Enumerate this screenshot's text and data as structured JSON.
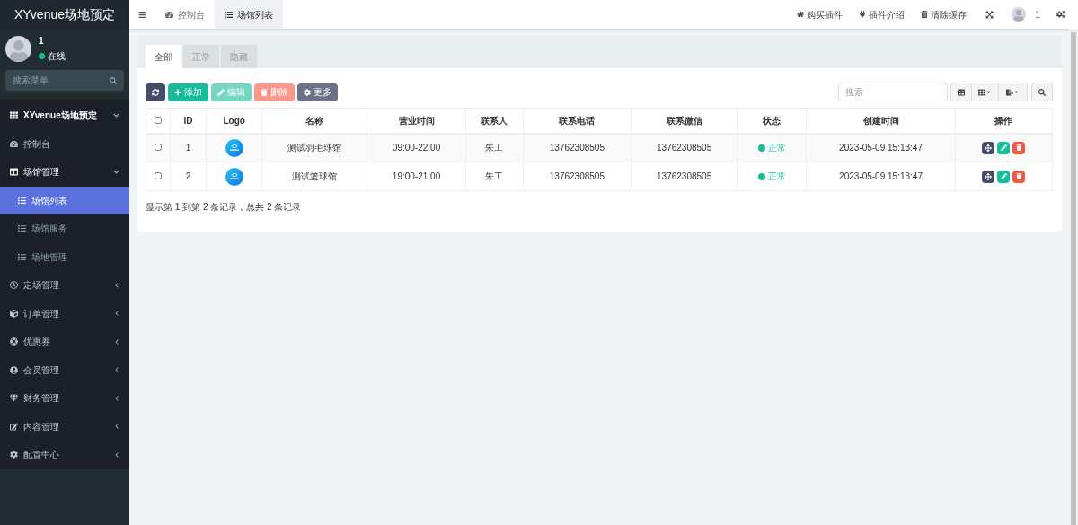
{
  "sidebar": {
    "brand": "XYvenue场地预定",
    "user": {
      "name": "1",
      "status": "在线",
      "online": true
    },
    "search": {
      "placeholder": "搜索菜单"
    },
    "menu": [
      {
        "kind": "header",
        "label": "XYvenue场地预定",
        "expanded": true
      },
      {
        "kind": "item",
        "label": "控制台",
        "selected": false
      },
      {
        "kind": "item",
        "label": "场馆管理",
        "expanded": true,
        "selected": false,
        "children": [
          {
            "label": "场馆列表",
            "selected": true
          },
          {
            "label": "场馆服务",
            "selected": false
          },
          {
            "label": "场地管理",
            "selected": false
          }
        ]
      },
      {
        "kind": "item",
        "label": "定场管理",
        "expanded": false,
        "selected": false
      },
      {
        "kind": "item",
        "label": "订单管理",
        "expanded": false,
        "selected": false
      },
      {
        "kind": "item",
        "label": "优惠券",
        "expanded": false,
        "selected": false
      },
      {
        "kind": "item",
        "label": "会员管理",
        "expanded": false,
        "selected": false
      },
      {
        "kind": "item",
        "label": "财务管理",
        "expanded": false,
        "selected": false
      },
      {
        "kind": "item",
        "label": "内容管理",
        "expanded": false,
        "selected": false
      },
      {
        "kind": "item",
        "label": "配置中心",
        "expanded": false,
        "selected": false
      }
    ]
  },
  "topbar": {
    "tabs": [
      {
        "label": "控制台",
        "selected": false
      },
      {
        "label": "场馆列表",
        "selected": true
      }
    ],
    "links": [
      "购买插件",
      "插件介绍",
      "清除缓存"
    ],
    "user": "1"
  },
  "filter_tabs": [
    {
      "label": "全部",
      "selected": true
    },
    {
      "label": "正常",
      "selected": false
    },
    {
      "label": "隐藏",
      "selected": false
    }
  ],
  "toolbar": {
    "buttons": [
      {
        "kind": "refresh",
        "disabled": false
      },
      {
        "kind": "add",
        "label": "添加",
        "disabled": false
      },
      {
        "kind": "edit",
        "label": "编辑",
        "disabled": true
      },
      {
        "kind": "delete",
        "label": "删除",
        "disabled": true
      },
      {
        "kind": "more",
        "label": "更多",
        "disabled": false
      }
    ],
    "search": {
      "placeholder": "搜索"
    }
  },
  "table": {
    "all_checked": false,
    "columns": [
      "ID",
      "Logo",
      "名称",
      "营业时间",
      "联系人",
      "联系电话",
      "联系微信",
      "状态",
      "创建时间",
      "操作"
    ],
    "rows": [
      {
        "checked": false,
        "id": "1",
        "name": "测试羽毛球馆",
        "hours": "09:00-22:00",
        "contact": "朱工",
        "phone": "13762308505",
        "wechat": "13762308505",
        "status": {
          "text": "正常",
          "color": "#18bc9c"
        },
        "created": "2023-05-09 15:13:47"
      },
      {
        "checked": false,
        "id": "2",
        "name": "测试篮球馆",
        "hours": "19:00-21:00",
        "contact": "朱工",
        "phone": "13762308505",
        "wechat": "13762308505",
        "status": {
          "text": "正常",
          "color": "#18bc9c"
        },
        "created": "2023-05-09 15:13:47"
      }
    ]
  },
  "pagination_info": "显示第 1 到第 2 条记录，总共 2 条记录"
}
